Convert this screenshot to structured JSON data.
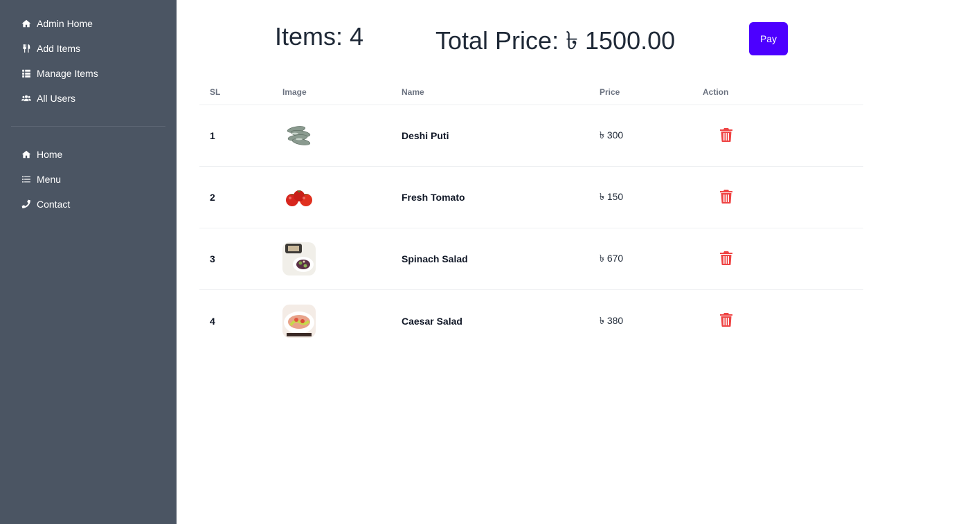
{
  "sidebar": {
    "admin_items": [
      {
        "label": "Admin Home",
        "icon": "home-icon"
      },
      {
        "label": "Add Items",
        "icon": "utensils-icon"
      },
      {
        "label": "Manage Items",
        "icon": "list-icon"
      },
      {
        "label": "All Users",
        "icon": "users-icon"
      }
    ],
    "public_items": [
      {
        "label": "Home",
        "icon": "home-icon"
      },
      {
        "label": "Menu",
        "icon": "list-bullets-icon"
      },
      {
        "label": "Contact",
        "icon": "phone-icon"
      }
    ]
  },
  "summary": {
    "items_label": "Items: 4",
    "total_label": "Total Price: ৳ 1500.00",
    "pay_label": "Pay"
  },
  "table": {
    "headers": {
      "sl": "SL",
      "image": "Image",
      "name": "Name",
      "price": "Price",
      "action": "Action"
    },
    "rows": [
      {
        "sl": "1",
        "name": "Deshi Puti",
        "price": "৳ 300",
        "image": "fish-thumbnail"
      },
      {
        "sl": "2",
        "name": "Fresh Tomato",
        "price": "৳ 150",
        "image": "tomato-thumbnail"
      },
      {
        "sl": "3",
        "name": "Spinach Salad",
        "price": "৳ 670",
        "image": "spinach-salad-thumbnail"
      },
      {
        "sl": "4",
        "name": "Caesar Salad",
        "price": "৳ 380",
        "image": "caesar-salad-thumbnail"
      }
    ]
  },
  "colors": {
    "sidebar_bg": "#4b5563",
    "pay_button": "#4c00ff",
    "delete_icon": "#ef4444"
  }
}
